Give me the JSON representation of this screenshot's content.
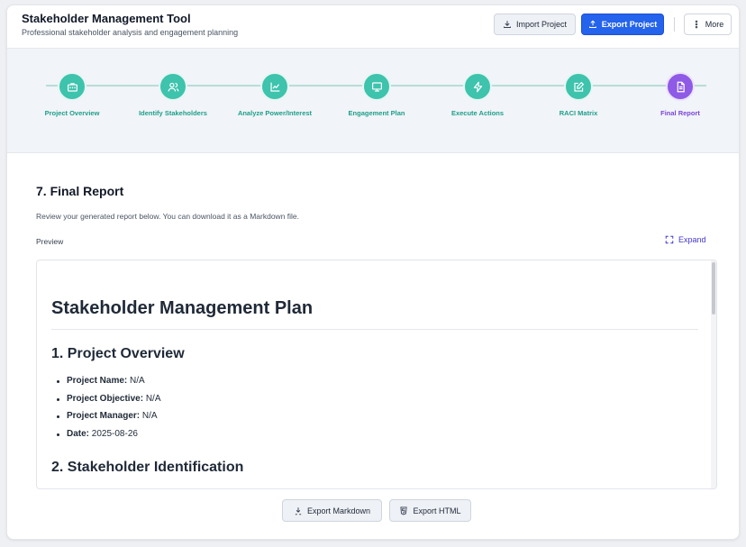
{
  "header": {
    "title": "Stakeholder Management Tool",
    "subtitle": "Professional stakeholder analysis and engagement planning",
    "import_label": "Import Project",
    "export_label": "Export Project",
    "more_label": "More"
  },
  "steps": [
    {
      "label": "Project Overview",
      "icon": "briefcase-icon",
      "state": "complete"
    },
    {
      "label": "Identify Stakeholders",
      "icon": "users-icon",
      "state": "complete"
    },
    {
      "label": "Analyze Power/Interest",
      "icon": "chart-icon",
      "state": "complete"
    },
    {
      "label": "Engagement Plan",
      "icon": "monitor-icon",
      "state": "complete"
    },
    {
      "label": "Execute Actions",
      "icon": "lightning-icon",
      "state": "complete"
    },
    {
      "label": "RACI Matrix",
      "icon": "edit-icon",
      "state": "complete"
    },
    {
      "label": "Final Report",
      "icon": "document-icon",
      "state": "active"
    }
  ],
  "main": {
    "title": "7. Final Report",
    "description": "Review your generated report below. You can download it as a Markdown file.",
    "preview_label": "Preview",
    "expand_label": "Expand"
  },
  "report": {
    "heading": "Stakeholder Management Plan",
    "section1": "1. Project Overview",
    "items": [
      {
        "key": "Project Name:",
        "value": "N/A"
      },
      {
        "key": "Project Objective:",
        "value": "N/A"
      },
      {
        "key": "Project Manager:",
        "value": "N/A"
      },
      {
        "key": "Date:",
        "value": "2025-08-26"
      }
    ],
    "section2": "2. Stakeholder Identification"
  },
  "footer": {
    "export_markdown_label": "Export Markdown",
    "export_html_label": "Export HTML"
  },
  "colors": {
    "primary": "#2463eb",
    "step_complete": "#3ec3ad",
    "step_active": "#8e5ae6",
    "link": "#4338ca"
  }
}
